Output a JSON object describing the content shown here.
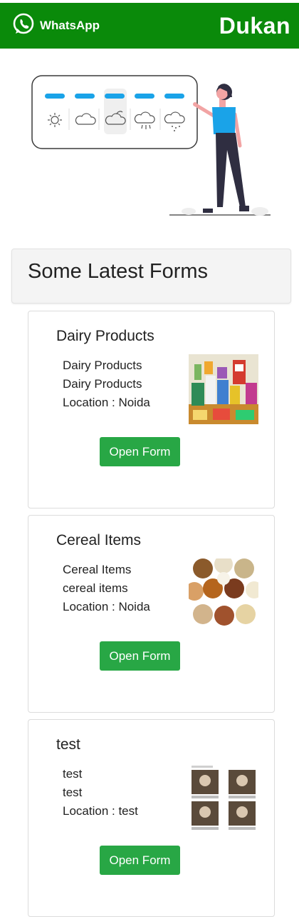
{
  "header": {
    "whatsapp_label": "WhatsApp",
    "brand": "Dukan",
    "bar_color": "#0a8a0a"
  },
  "hero": {
    "illustration": "weather-dashboard-illustration"
  },
  "section": {
    "title": "Some Latest Forms"
  },
  "forms": [
    {
      "title": "Dairy Products",
      "line1": "Dairy Products",
      "line2": "Dairy Products",
      "location": "Location : Noida",
      "button": "Open Form",
      "image": "dairy-products-photo"
    },
    {
      "title": "Cereal Items",
      "line1": "Cereal Items",
      "line2": "cereal items",
      "location": "Location : Noida",
      "button": "Open Form",
      "image": "cereal-grains-photo"
    },
    {
      "title": "test",
      "line1": "test",
      "line2": "test",
      "location": "Location : test",
      "button": "Open Form",
      "image": "test-collage-image"
    }
  ],
  "colors": {
    "button": "#28a745",
    "accent_blue": "#1aa3e8"
  }
}
